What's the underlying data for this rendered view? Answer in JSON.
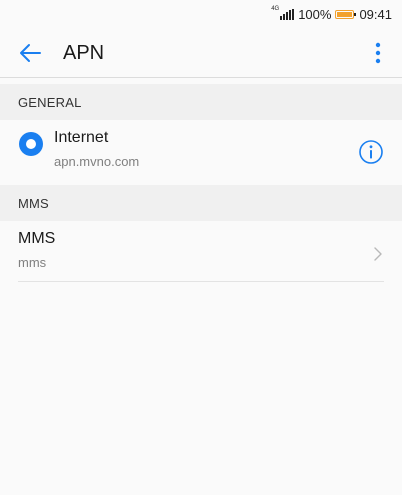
{
  "status_bar": {
    "network_type": "4G",
    "battery_percent": "100%",
    "battery_level": 1.0,
    "time": "09:41",
    "battery_color": "#f2a12c"
  },
  "app_bar": {
    "title": "APN",
    "back_icon": "arrow-left-icon",
    "menu_icon": "more-vertical-icon",
    "accent_color": "#1a7ff0"
  },
  "sections": {
    "general": {
      "header": "GENERAL",
      "item": {
        "title": "Internet",
        "subtitle": "apn.mvno.com",
        "selected": true,
        "action_icon": "info-icon"
      }
    },
    "mms": {
      "header": "MMS",
      "item": {
        "title": "MMS",
        "subtitle": "mms",
        "action_icon": "chevron-right-icon"
      }
    }
  }
}
